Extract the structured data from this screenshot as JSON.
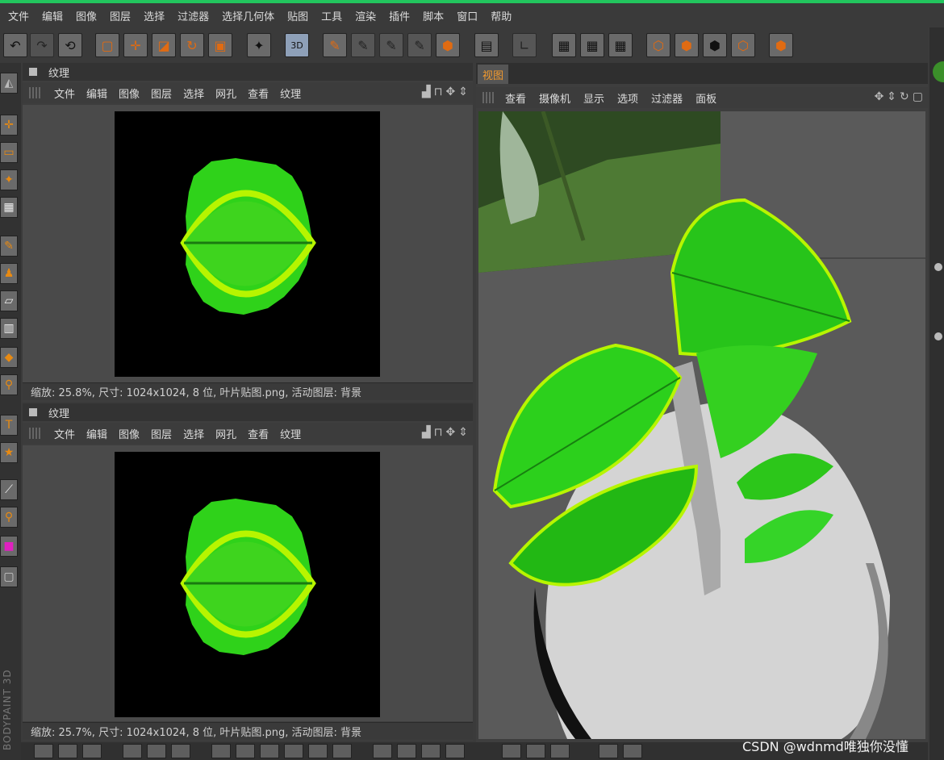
{
  "menu": [
    "文件",
    "编辑",
    "图像",
    "图层",
    "选择",
    "过滤器",
    "选择几何体",
    "贴图",
    "工具",
    "渲染",
    "插件",
    "脚本",
    "窗口",
    "帮助"
  ],
  "toolbar_icons": [
    "undo-icon",
    "redo-icon",
    "history-icon",
    "rect-select-icon",
    "move-icon",
    "scale-icon",
    "rotate-icon",
    "lock-icon",
    "magic-wand-icon",
    "paint-3d-icon",
    "brush-icon",
    "brush2-icon",
    "brush3-icon",
    "brush4-icon",
    "texture-icon",
    "clapper-icon",
    "axis-icon",
    "checker-icon",
    "checker2-icon",
    "checker3-icon",
    "cube-icon",
    "cube2-icon",
    "cube3-icon",
    "cube4-icon",
    "render-icon"
  ],
  "toolbar_tags": {
    "paint3d": "3D"
  },
  "left_tools": [
    "select-tool-icon",
    "move-tool-icon",
    "marquee-tool-icon",
    "wand-tool-icon",
    "checker-tool-icon",
    "brush-tool-icon",
    "stamp-tool-icon",
    "eraser-tool-icon",
    "gradient-tool-icon",
    "fill-tool-icon",
    "dodge-tool-icon",
    "text-tool-icon",
    "star-tool-icon",
    "picker-tool-icon",
    "zoom-tool-icon",
    "color-swatch-icon",
    "layer-tool-icon"
  ],
  "brand": "BODYPAINT 3D",
  "texture_panel_1": {
    "title": "纹理",
    "menu": [
      "文件",
      "编辑",
      "图像",
      "图层",
      "选择",
      "网孔",
      "查看",
      "纹理"
    ],
    "status": "缩放: 25.8%, 尺寸: 1024x1024, 8 位, 叶片贴图.png, 活动图层: 背景"
  },
  "texture_panel_2": {
    "title": "纹理",
    "menu": [
      "文件",
      "编辑",
      "图像",
      "图层",
      "选择",
      "网孔",
      "查看",
      "纹理"
    ],
    "status": "缩放: 25.7%, 尺寸: 1024x1024, 8 位, 叶片贴图.png, 活动图层: 背景"
  },
  "viewport": {
    "tab": "视图",
    "menu": [
      "查看",
      "摄像机",
      "显示",
      "选项",
      "过滤器",
      "面板"
    ]
  },
  "watermark": "CSDN @wdnmd唯独你没懂",
  "colors": {
    "accent": "#f29a2e",
    "leaf_green": "#2fd21a",
    "leaf_light": "#b7f500",
    "topline": "#22c55e"
  }
}
